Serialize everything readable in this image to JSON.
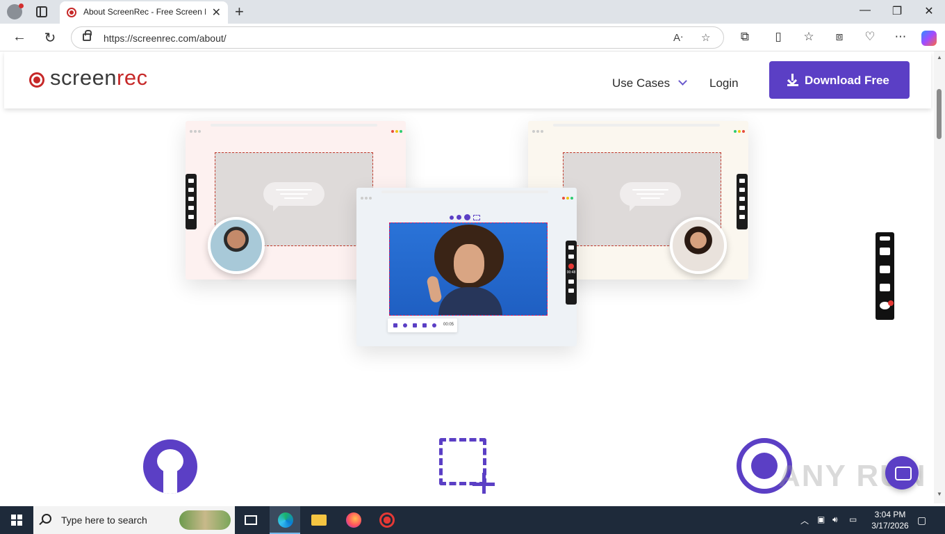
{
  "browser": {
    "tab_title": "About ScreenRec - Free Screen Re",
    "tab_close": "✕",
    "new_tab": "+",
    "url": "https://screenrec.com/about/",
    "window_minimize": "—",
    "window_restore": "❐",
    "window_close": "✕"
  },
  "site": {
    "logo_part1": "screen",
    "logo_part2": "rec",
    "nav_use_cases": "Use Cases",
    "nav_login": "Login",
    "download_button": "Download Free"
  },
  "mockup": {
    "timer": "00:05",
    "recording_timer": "00:48"
  },
  "watermark": "ANY RUN",
  "taskbar": {
    "search_placeholder": "Type here to search",
    "time": "3:04 PM",
    "date": "3/17/2026"
  },
  "colors": {
    "brand_purple": "#5b3fc5",
    "brand_red": "#c62828"
  }
}
